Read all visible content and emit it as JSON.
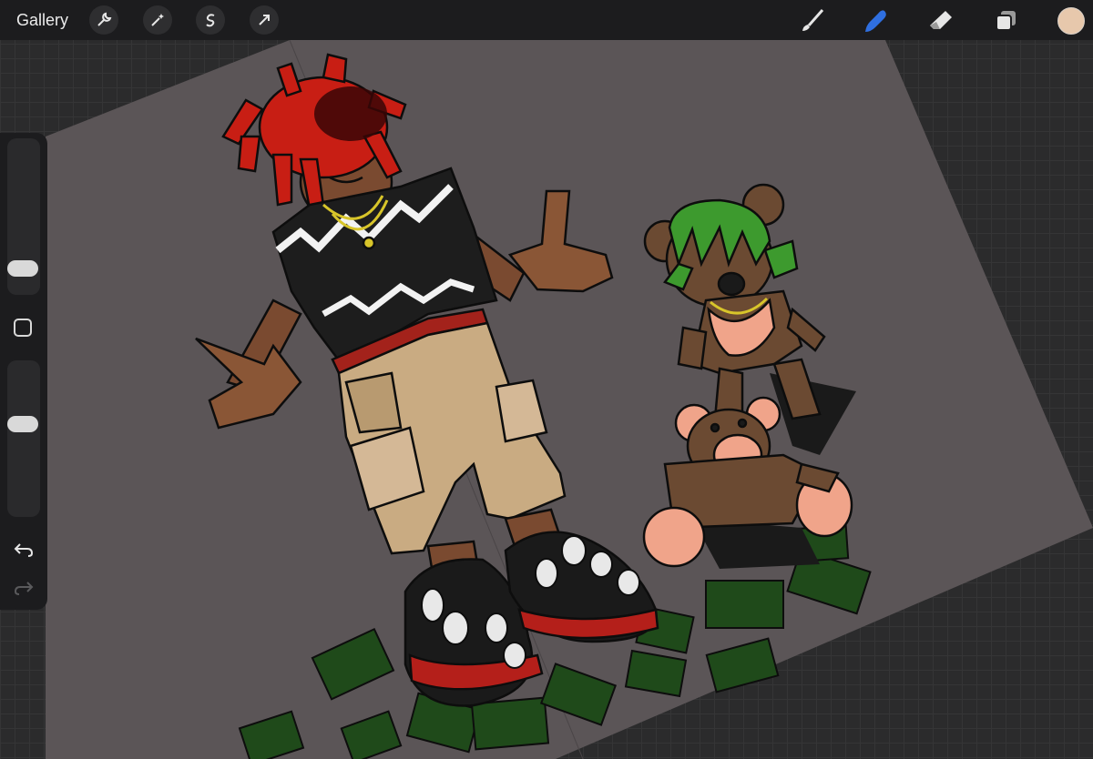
{
  "topbar": {
    "gallery_label": "Gallery",
    "left_tools": [
      "wrench-icon",
      "magic-wand-icon",
      "selection-icon",
      "transform-arrow-icon"
    ],
    "right_tools": [
      "brush-icon",
      "smudge-icon",
      "eraser-icon",
      "layers-icon"
    ],
    "active_tool": "smudge-icon",
    "accent_color": "#2f6fe0",
    "current_color": "#e7c8ac"
  },
  "sidebar": {
    "controls": [
      "brush-size-slider",
      "modify-button",
      "opacity-slider",
      "undo-icon",
      "redo-icon"
    ]
  },
  "canvas": {
    "paper_color": "#5b5557",
    "background_color": "#2b2b2c"
  }
}
